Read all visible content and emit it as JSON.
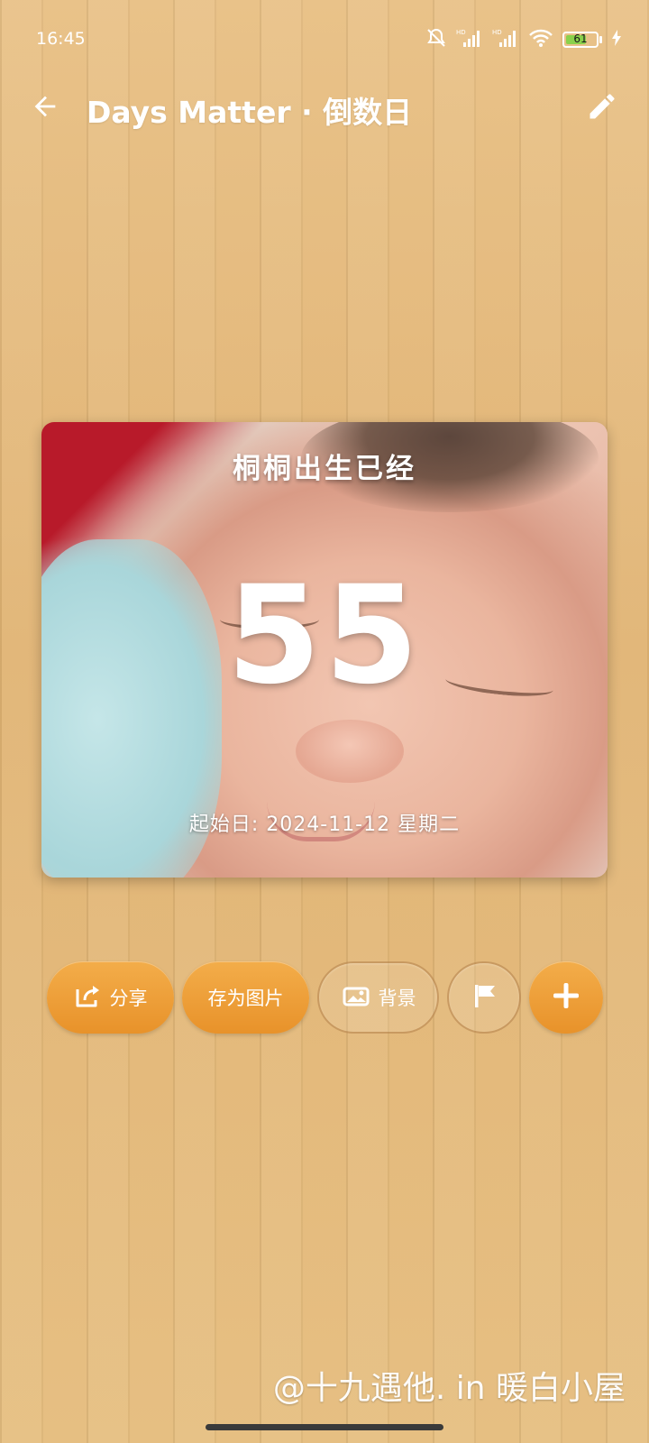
{
  "status_bar": {
    "time": "16:45",
    "battery_percent": "61",
    "icons": [
      "mute-bell-icon",
      "signal-hd-icon",
      "signal-hd-icon",
      "wifi-icon",
      "battery-icon",
      "charging-icon"
    ]
  },
  "app_bar": {
    "title": "Days Matter · 倒数日",
    "back_icon": "arrow-left-icon",
    "edit_icon": "pencil-icon"
  },
  "card": {
    "title": "桐桐出生已经",
    "number": "55",
    "date_text": "起始日: 2024-11-12 星期二"
  },
  "actions": {
    "share_label": "分享",
    "save_image_label": "存为图片",
    "background_label": "背景",
    "flag_icon": "flag-icon",
    "add_icon": "plus-icon"
  },
  "watermark": "@十九遇他. in 暖白小屋",
  "colors": {
    "accent": "#eb9a33",
    "wood": "#e2b876",
    "text_on_dark": "#ffffff"
  }
}
